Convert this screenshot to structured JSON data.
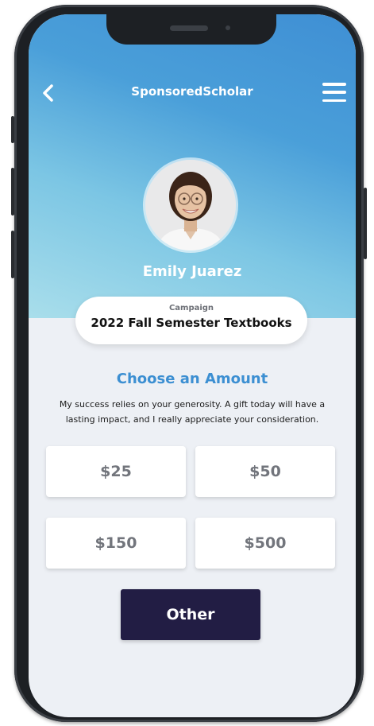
{
  "app": {
    "title": "SponsoredScholar"
  },
  "icons": {
    "back": "chevron-left-icon",
    "menu": "hamburger-menu-icon"
  },
  "profile": {
    "name": "Emily Juarez"
  },
  "campaign": {
    "label": "Campaign",
    "name": "2022 Fall Semester Textbooks"
  },
  "donation": {
    "heading": "Choose an Amount",
    "description": "My success relies on your generosity. A gift today will have a lasting impact, and I really appreciate your consideration.",
    "amounts": [
      "$25",
      "$50",
      "$150",
      "$500"
    ],
    "other_label": "Other"
  },
  "colors": {
    "accent_blue": "#3c8fd2",
    "other_button": "#221d44",
    "background": "#edf0f5"
  }
}
